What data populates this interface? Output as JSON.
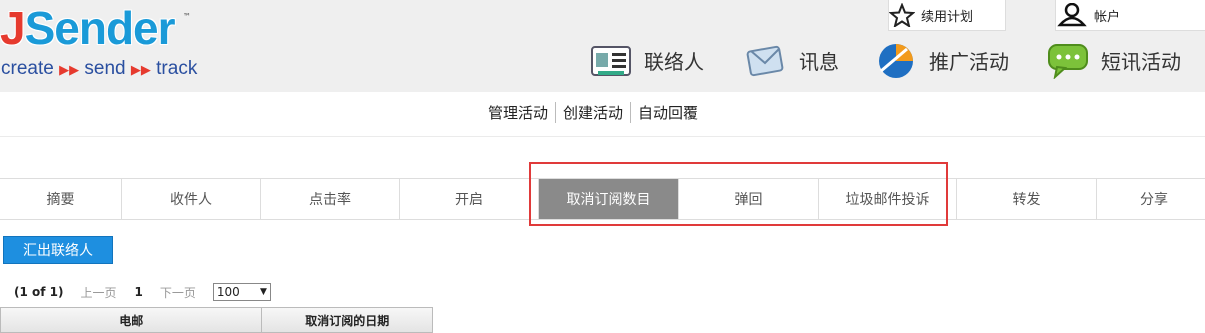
{
  "logo": {
    "main": "JSender",
    "tm": "™",
    "tag": [
      "create",
      "send",
      "track"
    ],
    "arrow": "▶▶"
  },
  "toplinks": {
    "renew": "续用计划",
    "account": "帐户"
  },
  "mainnav": [
    {
      "label": "联络人",
      "icon": "contact-card-icon"
    },
    {
      "label": "讯息",
      "icon": "envelope-icon"
    },
    {
      "label": "推广活动",
      "icon": "campaign-icon"
    },
    {
      "label": "短讯活动",
      "icon": "sms-bubble-icon"
    }
  ],
  "subnav": [
    "管理活动",
    "创建活动",
    "自动回覆"
  ],
  "tabs": [
    "摘要",
    "收件人",
    "点击率",
    "开启",
    "取消订阅数目",
    "弹回",
    "垃圾邮件投诉",
    "转发",
    "分享"
  ],
  "active_tab": "取消订阅数目",
  "export_button": "汇出联络人",
  "pager": {
    "info": "(1 of 1)",
    "prev": "上一页",
    "page": "1",
    "next": "下一页",
    "per_page": "100"
  },
  "table": {
    "columns": [
      "电邮",
      "取消订阅的日期"
    ]
  },
  "colors": {
    "accent": "#1e8fe0",
    "active_tab": "#8a8a8a",
    "highlight": "#e03a3a"
  }
}
